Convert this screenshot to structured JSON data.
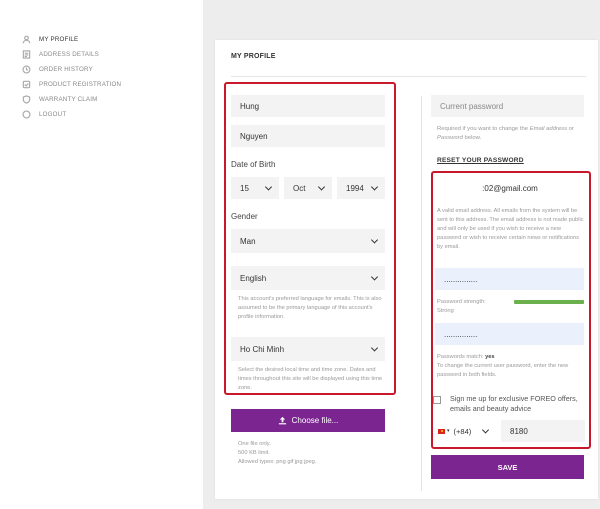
{
  "sidebar": {
    "items": [
      {
        "label": "MY PROFILE",
        "icon": "user-icon",
        "active": true
      },
      {
        "label": "ADDRESS DETAILS",
        "icon": "address-icon",
        "active": false
      },
      {
        "label": "ORDER HISTORY",
        "icon": "history-icon",
        "active": false
      },
      {
        "label": "PRODUCT REGISTRATION",
        "icon": "registration-icon",
        "active": false
      },
      {
        "label": "WARRANTY CLAIM",
        "icon": "warranty-icon",
        "active": false
      },
      {
        "label": "LOGOUT",
        "icon": "logout-icon",
        "active": false
      }
    ]
  },
  "card": {
    "title": "MY PROFILE"
  },
  "left": {
    "first_name": "Hung",
    "last_name": "Nguyen",
    "dob_label": "Date of Birth",
    "dob_day": "15",
    "dob_month": "Oct",
    "dob_year": "1994",
    "gender_label": "Gender",
    "gender_value": "Man",
    "language_value": "English",
    "language_help": "This account's preferred language for emails. This is also assumed to be the primary language of this account's profile information.",
    "timezone_value": "Ho Chi Minh",
    "timezone_help": "Select the desired local time and time zone. Dates and times throughout this site will be displayed using this time zone.",
    "choose_file_label": "Choose file...",
    "file_help_1": "One file only.",
    "file_help_2": "500 KB limit.",
    "file_help_3": "Allowed types: png gif jpg jpeg."
  },
  "right": {
    "current_password_placeholder": "Current password",
    "current_password_help_1": "Required if you want to change the",
    "current_password_help_em1": "Email address",
    "current_password_help_2": "or",
    "current_password_help_em2": "Password",
    "current_password_help_3": "below.",
    "reset_link": "RESET YOUR PASSWORD",
    "email_value": ":02@gmail.com",
    "email_help": "A valid email address. All emails from the system will be sent to this address. The email address is not made public and will only be used if you wish to receive a new password or wish to receive certain news or notifications by email.",
    "password_dots": "...............",
    "strength_label": "Password strength:",
    "strength_value": "Strong",
    "strength_color": "#6ab04c",
    "confirm_dots": "...............",
    "match_label": "Passwords match:",
    "match_value": "yes",
    "change_help": "To change the current user password, enter the new password in both fields.",
    "signup_label": "Sign me up for exclusive FOREO offers, emails and beauty advice",
    "phone_code": "(+84)",
    "phone_value": "8180",
    "save_label": "SAVE"
  },
  "colors": {
    "accent": "#7b2590",
    "highlight": "#c9182b",
    "background": "#ededed"
  }
}
